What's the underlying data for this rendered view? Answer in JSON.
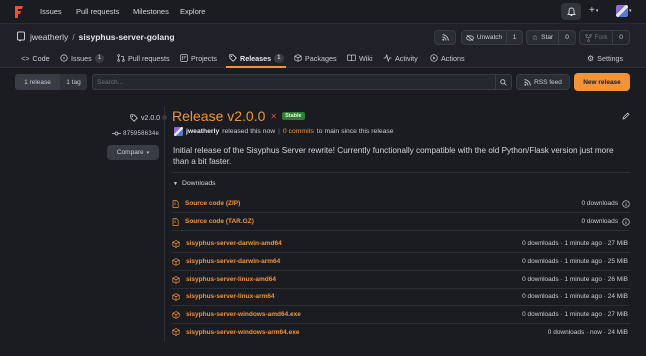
{
  "topnav": {
    "links": [
      "Issues",
      "Pull requests",
      "Milestones",
      "Explore"
    ]
  },
  "repo": {
    "owner": "jweatherly",
    "separator": "/",
    "name": "sisyphus-server-golang",
    "unwatch_label": "Unwatch",
    "unwatch_count": "1",
    "star_label": "Star",
    "star_count": "0",
    "fork_label": "Fork",
    "fork_count": "0"
  },
  "tabs": [
    {
      "label": "Code"
    },
    {
      "label": "Issues",
      "count": "1"
    },
    {
      "label": "Pull requests"
    },
    {
      "label": "Projects"
    },
    {
      "label": "Releases",
      "count": "1"
    },
    {
      "label": "Packages"
    },
    {
      "label": "Wiki"
    },
    {
      "label": "Activity"
    },
    {
      "label": "Actions"
    },
    {
      "label": "Settings"
    }
  ],
  "filter": {
    "releases_label": "1 release",
    "tags_label": "1 tag",
    "search_placeholder": "Search...",
    "rss_label": "RSS feed",
    "new_release_label": "New release"
  },
  "release": {
    "tag": "v2.0.0",
    "commit": "875958634e",
    "compare_label": "Compare",
    "title": "Release v2.0.0",
    "badge": "Stable",
    "author": "jweatherly",
    "released_text": "released this now",
    "commits_link": "0 commits",
    "commits_suffix": "to main since this release",
    "description": "Initial release of the Sisyphus Server rewrite! Currently functionally compatible with the old Python/Flask version just more than a bit faster.",
    "downloads_label": "Downloads",
    "source_archives": [
      {
        "name": "Source code (ZIP)",
        "meta": "0 downloads"
      },
      {
        "name": "Source code (TAR.GZ)",
        "meta": "0 downloads"
      }
    ],
    "assets": [
      {
        "name": "sisyphus-server-darwin-amd64",
        "meta": "0 downloads · 1 minute ago · 27 MiB"
      },
      {
        "name": "sisyphus-server-darwin-arm64",
        "meta": "0 downloads · 1 minute ago · 25 MiB"
      },
      {
        "name": "sisyphus-server-linux-amd64",
        "meta": "0 downloads · 1 minute ago · 26 MiB"
      },
      {
        "name": "sisyphus-server-linux-arm64",
        "meta": "0 downloads · 1 minute ago · 24 MiB"
      },
      {
        "name": "sisyphus-server-windows-amd64.exe",
        "meta": "0 downloads · 1 minute ago · 27 MiB"
      },
      {
        "name": "sisyphus-server-windows-arm64.exe",
        "meta": "0 downloads · now · 24 MiB"
      }
    ]
  },
  "colors": {
    "accent": "#f2933a",
    "stable_badge": "#2e7d32",
    "background": "#1b1c22"
  },
  "icons": [
    "logo-icon",
    "bell-icon",
    "plus-icon",
    "avatar",
    "repo-icon",
    "rss-icon",
    "eye-off-icon",
    "star-icon",
    "fork-icon",
    "code-icon",
    "issue-icon",
    "pull-request-icon",
    "projects-icon",
    "tag-icon",
    "package-icon",
    "wiki-icon",
    "activity-icon",
    "actions-icon",
    "gear-icon",
    "search-icon",
    "commit-icon",
    "chevron-down-icon",
    "edit-icon",
    "file-zip-icon",
    "package-asset-icon",
    "info-icon"
  ]
}
